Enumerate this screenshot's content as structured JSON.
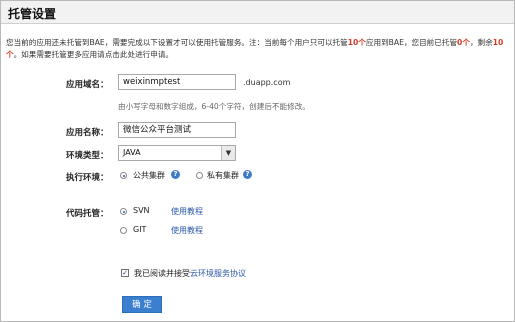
{
  "header": {
    "title": "托管设置"
  },
  "notice": {
    "part1": "您当前的应用还未托管到BAE，需要完成以下设置才可以使用托管服务。注：当前每个用户只可以托管",
    "limit": "10个",
    "part2": "应用到BAE，您目前已托管",
    "hosted": "0个",
    "part3": "，剩余",
    "remaining": "10个",
    "part4": "。如果需要托管更多应用请点击此处进行申请。"
  },
  "form": {
    "domain": {
      "label": "应用域名：",
      "value": "weixinmptest",
      "suffix": ".duapp.com",
      "hint": "由小写字母和数字组成，6-40个字符，创建后不能修改。"
    },
    "app_name": {
      "label": "应用名称：",
      "value": "微信公众平台测试"
    },
    "env_type": {
      "label": "环境类型：",
      "selected": "JAVA"
    },
    "exec_env": {
      "label": "执行环境：",
      "options": [
        "公共集群",
        "私有集群"
      ],
      "selected": "公共集群"
    },
    "code_hosting": {
      "label": "代码托管：",
      "options": [
        "SVN",
        "GIT"
      ],
      "selected": "SVN",
      "tutorial_link": "使用教程"
    },
    "agreement": {
      "text": "我已阅读并接受",
      "link": "云环境服务协议",
      "checked": true
    },
    "submit": "确 定"
  },
  "colors": {
    "accent": "#3a7fd0",
    "link": "#2a57a8",
    "highlight": "#d33a2c"
  },
  "icons": {
    "help": "question-circle-icon",
    "check": "checkmark-icon",
    "dropdown": "chevron-down-icon"
  }
}
